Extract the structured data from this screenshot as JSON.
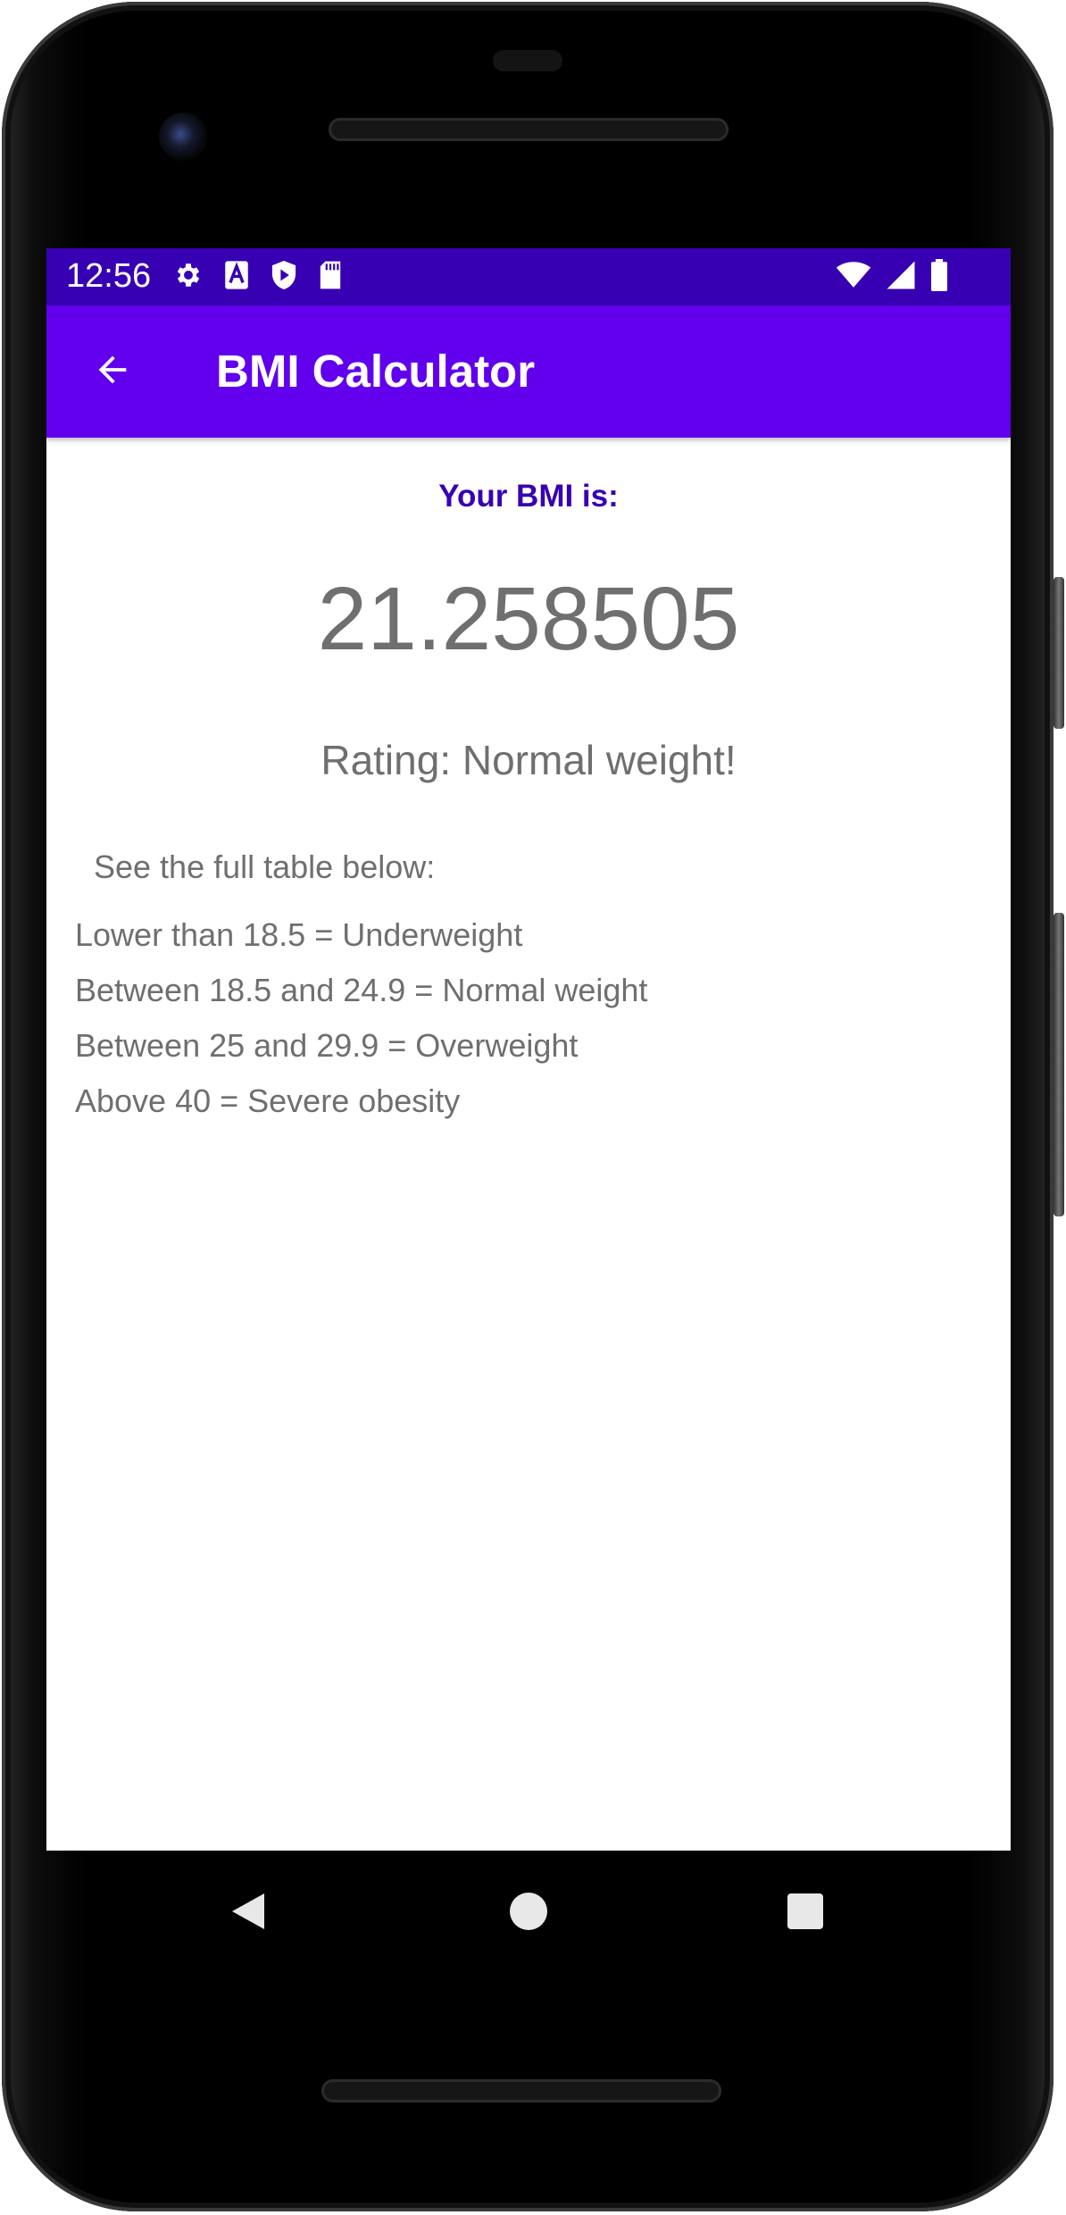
{
  "status_bar": {
    "time": "12:56",
    "left_icons": [
      "gear-icon",
      "font-a-icon",
      "shield-play-icon",
      "sd-card-icon"
    ],
    "right_icons": [
      "wifi-icon",
      "signal-icon",
      "battery-icon"
    ]
  },
  "app_bar": {
    "title": "BMI Calculator",
    "back_icon": "arrow-left-icon",
    "color": "#6200ee",
    "status_color": "#3700b3"
  },
  "result": {
    "label": "Your BMI is:",
    "value": "21.258505",
    "rating": "Rating: Normal weight!"
  },
  "table": {
    "intro": "See the full table below:",
    "rows": [
      "Lower than 18.5 = Underweight",
      "Between 18.5 and 24.9 = Normal weight",
      "Between 25 and 29.9 = Overweight",
      "Above 40 = Severe obesity"
    ]
  },
  "nav": {
    "back": "nav-back-icon",
    "home": "nav-home-icon",
    "recents": "nav-recents-icon"
  }
}
